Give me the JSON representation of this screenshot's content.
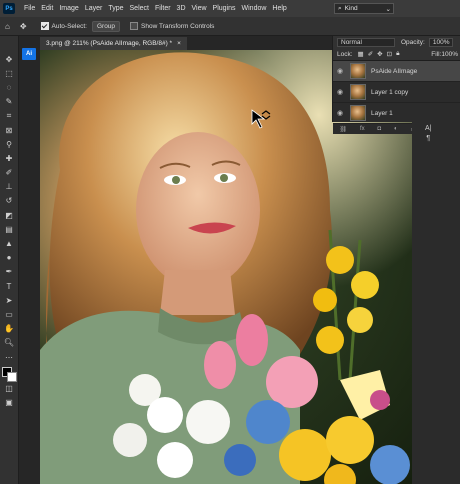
{
  "menu": {
    "logo": "Ps",
    "items": [
      "File",
      "Edit",
      "Image",
      "Layer",
      "Type",
      "Select",
      "Filter",
      "3D",
      "View",
      "Plugins",
      "Window",
      "Help"
    ]
  },
  "options": {
    "auto_select_label": "Auto-Select:",
    "auto_select_value": "Group",
    "transform_label": "Show Transform Controls",
    "kind_label": "Kind"
  },
  "layers_panel": {
    "blend_mode": "Normal",
    "opacity_label": "Opacity:",
    "opacity_value": "100%",
    "lock_label": "Lock:",
    "fill_label": "Fill:",
    "fill_value": "100%",
    "layers": [
      {
        "name": "PsAide AIImage",
        "selected": true
      },
      {
        "name": "Layer 1 copy",
        "selected": false
      },
      {
        "name": "Layer 1",
        "selected": false
      }
    ]
  },
  "document": {
    "tab_title": "3.png @ 211% (PsAide AIImage, RGB/8#) *",
    "panel_toggle": "Ai"
  },
  "colors": {
    "accent": "#1473e6",
    "app_bg": "#262626",
    "menubar": "#3b3b3b"
  }
}
